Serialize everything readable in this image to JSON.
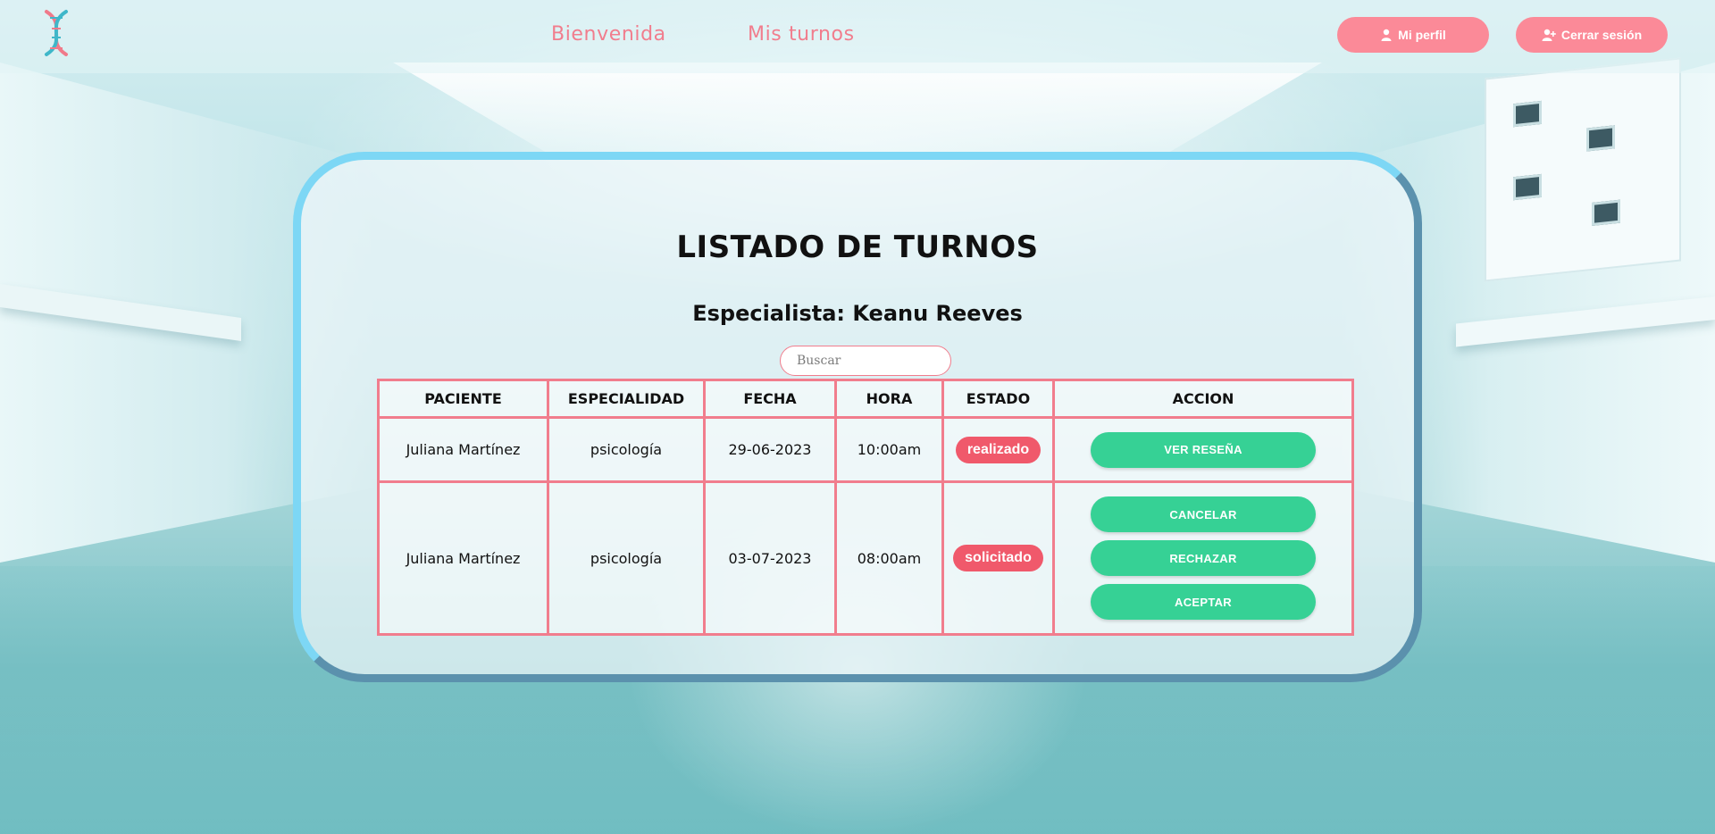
{
  "nav": {
    "links": [
      "Bienvenida",
      "Mis turnos"
    ],
    "profile_label": "Mi perfil",
    "logout_label": "Cerrar sesión",
    "logo_icon": "dna-icon"
  },
  "main": {
    "title": "LISTADO DE TURNOS",
    "subtitle": "Especialista: Keanu Reeves",
    "search": {
      "placeholder": "Buscar",
      "value": ""
    },
    "table": {
      "headers": [
        "PACIENTE",
        "ESPECIALIDAD",
        "FECHA",
        "HORA",
        "ESTADO",
        "ACCION"
      ],
      "rows": [
        {
          "paciente": "Juliana Martínez",
          "especialidad": "psicología",
          "fecha": "29-06-2023",
          "hora": "10:00am",
          "estado": "realizado",
          "acciones": [
            "VER RESEÑA"
          ]
        },
        {
          "paciente": "Juliana Martínez",
          "especialidad": "psicología",
          "fecha": "03-07-2023",
          "hora": "08:00am",
          "estado": "solicitado",
          "acciones": [
            "CANCELAR",
            "RECHAZAR",
            "ACEPTAR"
          ]
        }
      ]
    }
  },
  "colors": {
    "accent_pink": "#f17d8d",
    "button_pink": "#fb8a98",
    "status_red": "#f0596b",
    "action_green": "#36d195",
    "card_border": "#7dd7f5"
  }
}
